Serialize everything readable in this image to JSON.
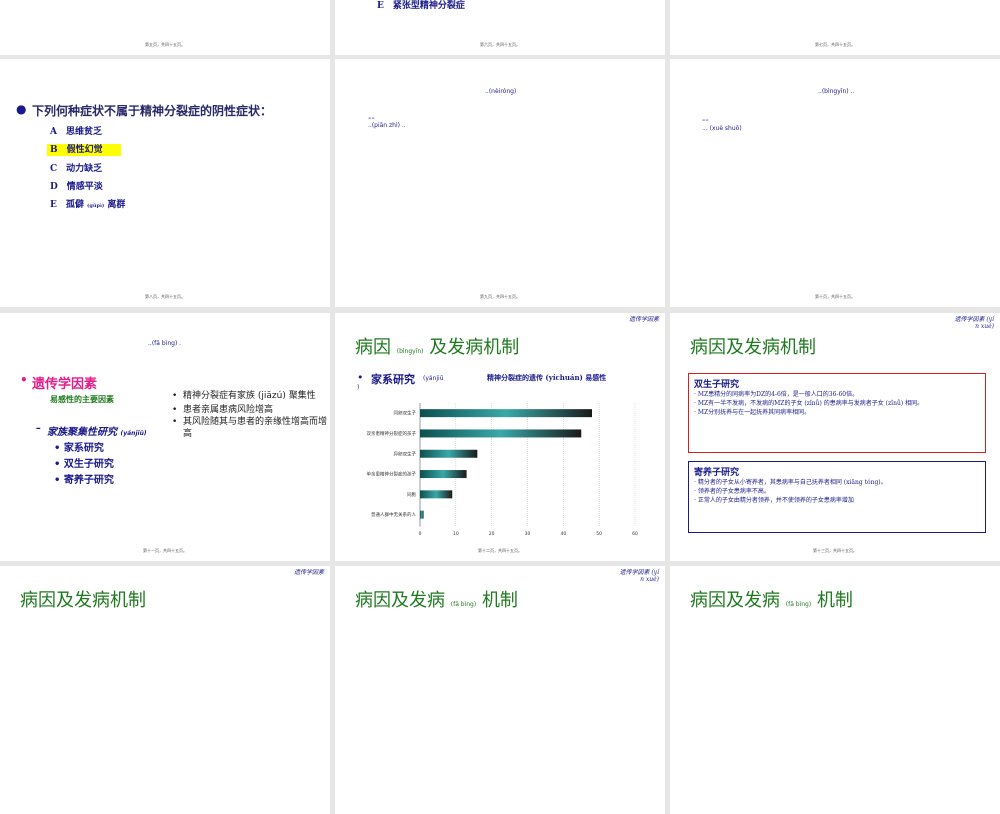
{
  "slide1": {
    "footer": "第五页，共四十五页。"
  },
  "slide2": {
    "top_option": "E　紧张型精神分裂症",
    "footer": "第六页，共四十五页。"
  },
  "slide3": {
    "footer": "第七页，共四十五页。"
  },
  "slide4": {
    "question": "下列何种症状不属于精神分裂症的阴性症状：",
    "options": [
      {
        "text": "A　思维贫乏"
      },
      {
        "text": "B　假性幻觉"
      },
      {
        "text": "C　动力缺乏"
      },
      {
        "text": "D　情感平淡"
      },
      {
        "text": "E　孤僻",
        "ruby": "(gūpì)",
        "after": "离群"
      }
    ],
    "highlight_color": "#ffff00",
    "footer": "第八页，共四十五页。"
  },
  "slide5": {
    "line1": "..(nèiróng)",
    "small_mark": "==",
    "line2": "..(piān zhì) ..",
    "footer": "第九页，共四十五页。"
  },
  "slide6": {
    "line1": "..(bìngyīn) ..",
    "small_mark": "==",
    "line2": "... (xuè shuō)",
    "footer": "第十页，共四十五页。"
  },
  "slide7": {
    "top_line": "..(fā bìng) .",
    "heading": "遗传学因素",
    "subheading": "易感性的主要因素",
    "research_title": "家族聚集性研究",
    "research_ruby": "(yánjiū)",
    "research_items": [
      "家系研究",
      "双生子研究",
      "寄养子研究"
    ],
    "right_items": [
      "精神分裂症有家族 (jiāzú) 聚集性",
      "患者亲属患病风险增高",
      "其风险随其与患者的亲缘性增高而增高"
    ],
    "heading_color": "#e61e8c",
    "footer": "第十一页，共四十五页。"
  },
  "slide8": {
    "tag": "遗传学因素",
    "title": "病因",
    "title_ruby": "(bìngyīn)",
    "title_rest": "及发病机制",
    "bullet": "家系研究",
    "bullet_ruby": "(yánjiū",
    "bullet_close": ")",
    "bullet_desc": "精神分裂症的遗传 (yíchuán) 易感性",
    "footer": "第十二页，共四十五页。",
    "chart_data": {
      "type": "bar",
      "orientation": "horizontal",
      "categories": [
        "同卵双生子",
        "双亲患精神分裂症的孩子",
        "异卵双生子",
        "单亲患精神分裂症的孩子",
        "同胞",
        "普通人群中无关系的人"
      ],
      "values": [
        48,
        45,
        16,
        13,
        9,
        1
      ],
      "x_ticks": [
        "0",
        "10",
        "20",
        "30",
        "40",
        "50",
        "60"
      ],
      "xlim": [
        0,
        60
      ],
      "bar_color": "#1f7a7a"
    }
  },
  "slide9": {
    "tag_line1": "遗传学因素 (yí",
    "tag_line2": "n xué)",
    "title": "病因及发病机制",
    "twin_title": "双生子研究",
    "twin_items": [
      "MZ患精分的同病率为DZ的4-6倍，是一般人口的36-60倍。",
      "MZ有一半不发病，不发病的MZ的子女 (zǐnǚ) 的患病率与发病者子女 (zǐnǚ) 相同。",
      "MZ分别抚养与在一起抚养其同病率相同。"
    ],
    "adopt_title": "寄养子研究",
    "adopt_items": [
      "精分者的子女从小寄养者，其患病率与自己抚养者相同 (xiāng tóng)。",
      "领养者的子女患病率不高。",
      "正常人的子女由精分者领养，并不使领养的子女患病率增加"
    ],
    "twin_border": "#d62020",
    "adopt_border": "#1a1a8c",
    "footer": "第十三页，共四十五页。"
  },
  "slide10": {
    "tag": "遗传学因素",
    "title": "病因及发病机制"
  },
  "slide11": {
    "tag_line1": "遗传学因素 (yí",
    "tag_line2": "n xué)",
    "title_a": "病因及发病",
    "title_ruby": "(fā bìng)",
    "title_b": "机制"
  },
  "slide12": {
    "title_a": "病因及发病",
    "title_ruby": "(fā bìng)",
    "title_b": "机制"
  }
}
